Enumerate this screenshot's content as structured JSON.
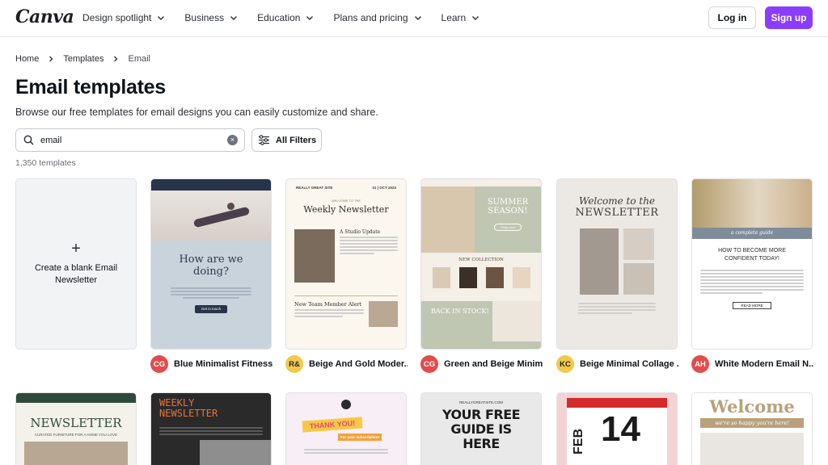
{
  "nav": {
    "logo": "Canva",
    "items": [
      "Design spotlight",
      "Business",
      "Education",
      "Plans and pricing",
      "Learn"
    ],
    "login": "Log in",
    "signup": "Sign up",
    "accent_color": "#8b3dff"
  },
  "breadcrumb": {
    "home": "Home",
    "templates": "Templates",
    "current": "Email"
  },
  "header": {
    "title": "Email templates",
    "subtitle": "Browse our free templates for email designs you can easily customize and share."
  },
  "search": {
    "value": "email",
    "filters_label": "All Filters",
    "count": "1,350 templates"
  },
  "blank_card": {
    "plus": "+",
    "label": "Create a blank Email Newsletter"
  },
  "templates": [
    {
      "initials": "CG",
      "avatar_color": "#e14d4d",
      "title": "Blue Minimalist Fitness...",
      "body": {
        "heading": "How are we doing?",
        "button": "Get in touch"
      }
    },
    {
      "initials": "R&",
      "avatar_color": "#f2c94c",
      "title": "Beige And Gold Moder...",
      "body": {
        "top_left": "REALLY GREAT SITE",
        "top_right": "01 | OCT 2023",
        "welcome": "WELCOME TO THE",
        "heading": "Weekly Newsletter",
        "sub": "A Studio Update",
        "member": "New Team Member Alert"
      }
    },
    {
      "initials": "CG",
      "avatar_color": "#e14d4d",
      "title": "Green and Beige Minim...",
      "body": {
        "heading": "SUMMER SEASON!",
        "button": "Shop now",
        "collection": "NEW COLLECTION",
        "back": "BACK IN STOCK!"
      }
    },
    {
      "initials": "KC",
      "avatar_color": "#f2c94c",
      "title": "Beige Minimal Collage ...",
      "body": {
        "script": "Welcome to the",
        "heading": "NEWSLETTER"
      }
    },
    {
      "initials": "AH",
      "avatar_color": "#e14d4d",
      "title": "White Modern Email N...",
      "body": {
        "banner": "a complete guide",
        "heading": "HOW TO BECOME MORE CONFIDENT TODAY!",
        "button": "READ MORE"
      }
    }
  ],
  "row2": [
    {
      "heading": "NEWSLETTER",
      "sub": "CURATED FURNITURE FOR A HOME YOU LOVE"
    },
    {
      "heading": "WEEKLY NEWSLETTER"
    },
    {
      "heading": "THANK YOU!",
      "sub": "For your subscription!"
    },
    {
      "top": "REALLYGREATSITE.COM",
      "heading": "YOUR FREE GUIDE IS HERE"
    },
    {
      "month": "FEB",
      "day": "14"
    },
    {
      "heading": "Welcome",
      "sub": "we're so happy you're here!"
    }
  ]
}
